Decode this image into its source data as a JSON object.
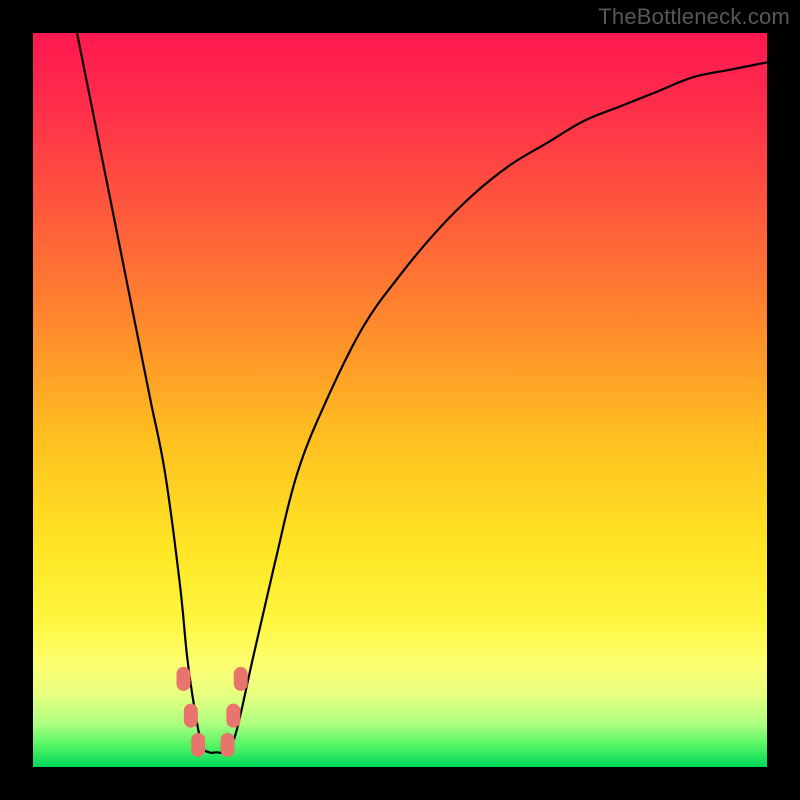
{
  "watermark": "TheBottleneck.com",
  "chart_data": {
    "type": "line",
    "title": "",
    "xlabel": "",
    "ylabel": "",
    "xlim": [
      0,
      100
    ],
    "ylim": [
      0,
      100
    ],
    "grid": false,
    "series": [
      {
        "name": "curve",
        "x": [
          6,
          8,
          10,
          12,
          14,
          16,
          18,
          20,
          21,
          22,
          23,
          24,
          25,
          26,
          27,
          28,
          30,
          33,
          36,
          40,
          45,
          50,
          55,
          60,
          65,
          70,
          75,
          80,
          85,
          90,
          95,
          100
        ],
        "y": [
          100,
          90,
          80,
          70,
          60,
          50,
          40,
          25,
          15,
          8,
          3,
          2,
          2,
          2,
          3,
          6,
          15,
          28,
          40,
          50,
          60,
          67,
          73,
          78,
          82,
          85,
          88,
          90,
          92,
          94,
          95,
          96
        ]
      }
    ],
    "markers": [
      {
        "x": 20.5,
        "y": 12
      },
      {
        "x": 21.5,
        "y": 7
      },
      {
        "x": 22.5,
        "y": 3
      },
      {
        "x": 26.5,
        "y": 3
      },
      {
        "x": 27.3,
        "y": 7
      },
      {
        "x": 28.3,
        "y": 12
      }
    ],
    "gradient_stops": [
      {
        "offset": 0.0,
        "color": "#ff1850"
      },
      {
        "offset": 0.1,
        "color": "#ff2e4a"
      },
      {
        "offset": 0.25,
        "color": "#ff5b3b"
      },
      {
        "offset": 0.4,
        "color": "#ff8a2c"
      },
      {
        "offset": 0.55,
        "color": "#ffbf20"
      },
      {
        "offset": 0.7,
        "color": "#ffe524"
      },
      {
        "offset": 0.8,
        "color": "#fff63e"
      },
      {
        "offset": 0.86,
        "color": "#fdff70"
      },
      {
        "offset": 0.9,
        "color": "#e8ff80"
      },
      {
        "offset": 0.94,
        "color": "#b0ff80"
      },
      {
        "offset": 0.97,
        "color": "#55f565"
      },
      {
        "offset": 1.0,
        "color": "#00d858"
      }
    ]
  }
}
